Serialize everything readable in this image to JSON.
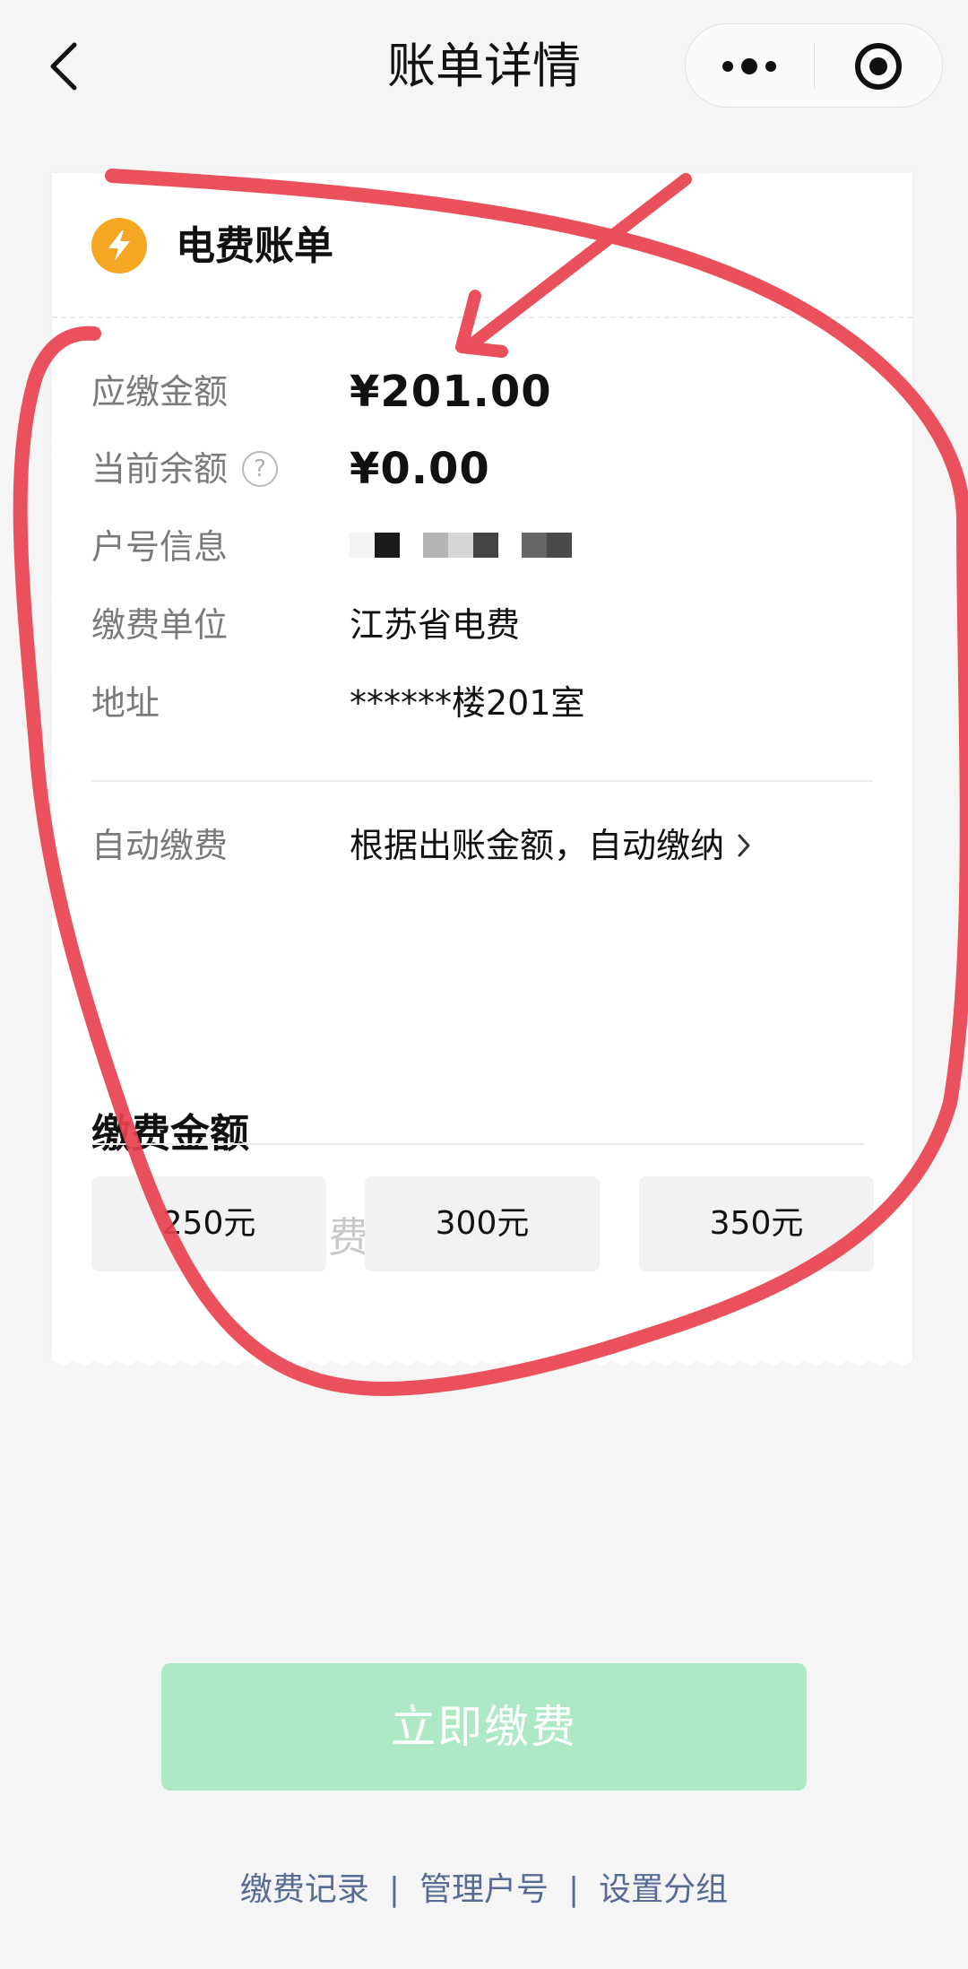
{
  "nav": {
    "title": "账单详情"
  },
  "bill": {
    "title": "电费账单",
    "rows": {
      "amount_due": {
        "label": "应缴金额",
        "value": "¥201.00"
      },
      "balance": {
        "label": "当前余额",
        "value": "¥0.00",
        "help": "?"
      },
      "account": {
        "label": "户号信息"
      },
      "payee": {
        "label": "缴费单位",
        "value": "江苏省电费"
      },
      "address": {
        "label": "地址",
        "value": "******楼201室"
      },
      "auto_pay": {
        "label": "自动缴费",
        "value": "根据出账金额，自动缴纳"
      }
    },
    "payment": {
      "title": "缴费金额",
      "currency": "¥",
      "placeholder": "请输入缴费金额",
      "presets": [
        "250元",
        "300元",
        "350元"
      ]
    }
  },
  "actions": {
    "pay_now": "立即缴费"
  },
  "footer": {
    "links": [
      "缴费记录",
      "管理户号",
      "设置分组"
    ],
    "separator": "|"
  },
  "colors": {
    "accent_green_disabled": "#aee9c6",
    "bolt_orange": "#f5a623",
    "link_blue": "#576b95",
    "annotation_red": "#e8424f"
  },
  "icons": [
    "back-chevron-icon",
    "more-dots-icon",
    "target-icon",
    "lightning-bolt-icon",
    "help-circle-icon",
    "chevron-right-icon"
  ]
}
